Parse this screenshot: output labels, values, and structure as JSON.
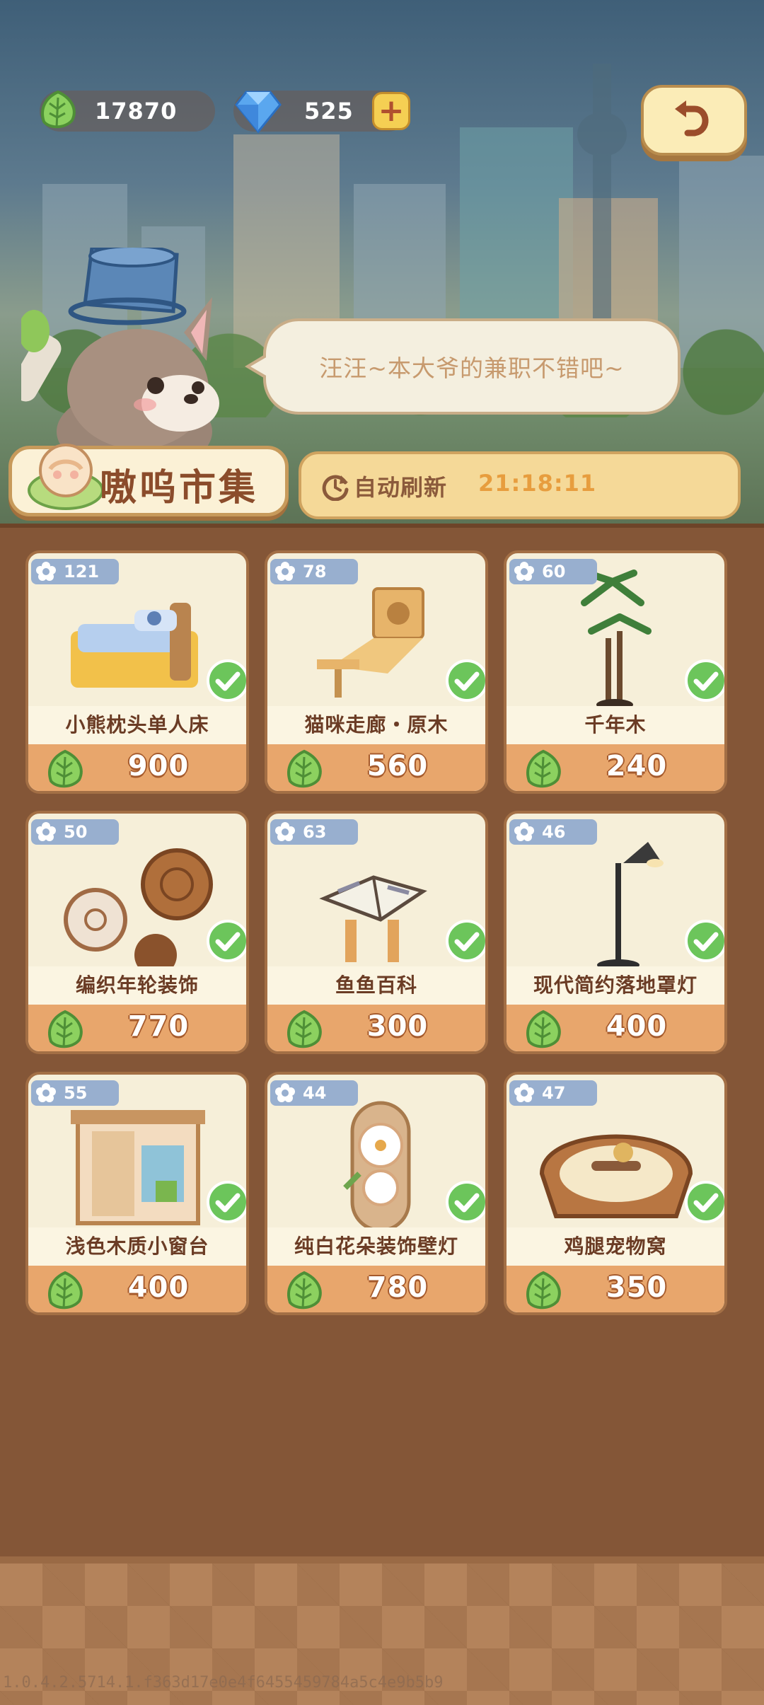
{
  "currency": {
    "leaf_amount": "17870",
    "gem_amount": "525",
    "add_label": "+"
  },
  "dialog": {
    "speech": "汪汪~本大爷的兼职不错吧~"
  },
  "market": {
    "title": "嗷呜市集",
    "refresh_label": "自动刷新",
    "refresh_timer": "21:18:11"
  },
  "items": [
    {
      "count": "121",
      "name": "小熊枕头单人床",
      "price": "900",
      "owned": true,
      "icon": "bed-icon"
    },
    {
      "count": "78",
      "name": "猫咪走廊・原木",
      "price": "560",
      "owned": true,
      "icon": "cat-walkway-icon"
    },
    {
      "count": "60",
      "name": "千年木",
      "price": "240",
      "owned": true,
      "icon": "plant-icon"
    },
    {
      "count": "50",
      "name": "编织年轮装饰",
      "price": "770",
      "owned": true,
      "icon": "woven-ring-icon"
    },
    {
      "count": "63",
      "name": "鱼鱼百科",
      "price": "300",
      "owned": true,
      "icon": "book-icon"
    },
    {
      "count": "46",
      "name": "现代简约落地罩灯",
      "price": "400",
      "owned": true,
      "icon": "floor-lamp-icon"
    },
    {
      "count": "55",
      "name": "浅色木质小窗台",
      "price": "400",
      "owned": true,
      "icon": "window-sill-icon"
    },
    {
      "count": "44",
      "name": "纯白花朵装饰壁灯",
      "price": "780",
      "owned": true,
      "icon": "flower-lamp-icon"
    },
    {
      "count": "47",
      "name": "鸡腿宠物窝",
      "price": "350",
      "owned": true,
      "icon": "pet-bed-icon"
    }
  ],
  "build_id": "1.0.4.2.5714.1.f363d17e0e4f6455459784a5c4e9b5b9",
  "colors": {
    "accent_green": "#6cc55b",
    "price_bar": "#e8a66c",
    "badge_blue": "#98afcf",
    "board_brown": "#845637"
  }
}
